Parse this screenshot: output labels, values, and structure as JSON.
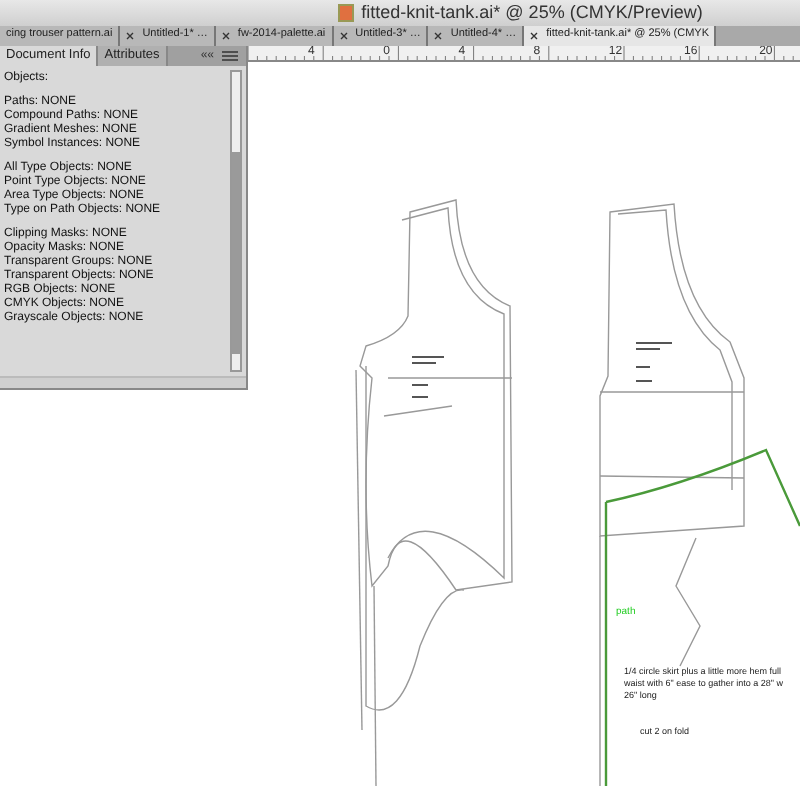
{
  "window": {
    "title": "fitted-knit-tank.ai* @ 25% (CMYK/Preview)"
  },
  "tabs": [
    {
      "label": "cing trouser pattern.ai",
      "closable": false,
      "selected": false
    },
    {
      "label": "Untitled-1* …",
      "closable": true,
      "selected": false
    },
    {
      "label": "fw-2014-palette.ai",
      "closable": true,
      "selected": false
    },
    {
      "label": "Untitled-3* …",
      "closable": true,
      "selected": false
    },
    {
      "label": "Untitled-4* …",
      "closable": true,
      "selected": false
    },
    {
      "label": "fitted-knit-tank.ai* @ 25% (CMYK",
      "closable": true,
      "selected": true
    }
  ],
  "ruler": {
    "labels": [
      "4",
      "0",
      "4",
      "8",
      "12",
      "16",
      "20"
    ]
  },
  "panel": {
    "tabs": [
      {
        "label": "Document Info",
        "selected": true
      },
      {
        "label": "Attributes",
        "selected": false
      }
    ],
    "collapse": "««",
    "groups": [
      [
        "Objects:"
      ],
      [
        "Paths: NONE",
        "Compound Paths: NONE",
        "Gradient Meshes: NONE",
        "Symbol Instances: NONE"
      ],
      [
        "All Type Objects: NONE",
        "Point Type Objects: NONE",
        "Area Type Objects: NONE",
        "Type on Path Objects: NONE"
      ],
      [
        "Clipping Masks: NONE",
        "Opacity Masks: NONE",
        "Transparent Groups: NONE",
        "Transparent Objects: NONE",
        "RGB Objects: NONE",
        "CMYK Objects: NONE",
        "Grayscale Objects: NONE"
      ]
    ]
  },
  "canvas": {
    "path_label": "path",
    "notes": [
      "1/4 circle skirt plus a little more hem full",
      "waist with 6\" ease to gather into a 28\" w",
      "26\" long"
    ],
    "cut_note": "cut 2 on fold"
  }
}
